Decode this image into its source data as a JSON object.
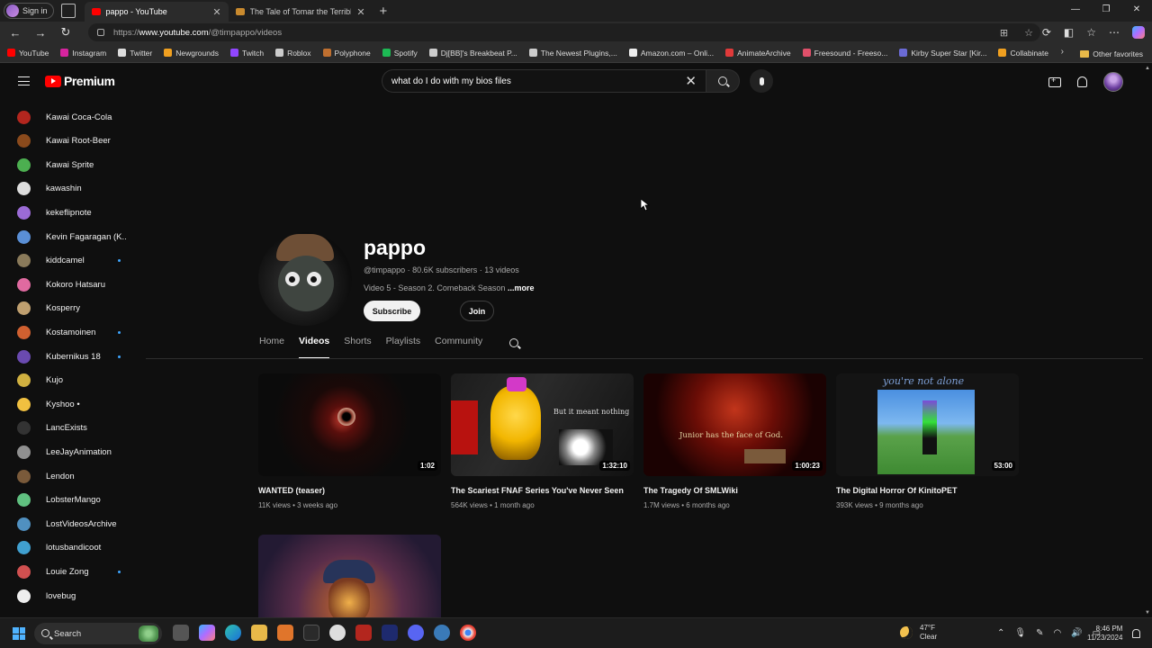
{
  "browser": {
    "signin_label": "Sign in",
    "tabs": [
      {
        "title": "pappo - YouTube",
        "favicon_color": "#ff0000",
        "active": true
      },
      {
        "title": "The Tale of Tomar the Terrible (Ar",
        "favicon_color": "#c98a2e",
        "active": false
      }
    ],
    "url_prefix": "https://",
    "url_host": "www.youtube.com",
    "url_path": "/@timpappo/videos",
    "bookmarks": [
      {
        "label": "YouTube",
        "color": "#ff0000"
      },
      {
        "label": "Instagram",
        "color": "#d6249f"
      },
      {
        "label": "Twitter",
        "color": "#dddddd"
      },
      {
        "label": "Newgrounds",
        "color": "#f0a020"
      },
      {
        "label": "Twitch",
        "color": "#9146ff"
      },
      {
        "label": "Roblox",
        "color": "#cccccc"
      },
      {
        "label": "Polyphone",
        "color": "#c07030"
      },
      {
        "label": "Spotify",
        "color": "#1db954"
      },
      {
        "label": "Dj[BB]'s Breakbeat P...",
        "color": "#cccccc"
      },
      {
        "label": "The Newest Plugins,...",
        "color": "#cccccc"
      },
      {
        "label": "Amazon.com – Onli...",
        "color": "#eeeeee"
      },
      {
        "label": "AnimateArchive",
        "color": "#e03a3a"
      },
      {
        "label": "Freesound - Freeso...",
        "color": "#e0506a"
      },
      {
        "label": "Kirby Super Star [Kir...",
        "color": "#6b6bd6"
      },
      {
        "label": "Collabinate",
        "color": "#f0a020"
      }
    ],
    "other_favorites": "Other favorites"
  },
  "youtube": {
    "logo_text": "Premium",
    "search_query": "what do I do with my bios files",
    "sidebar_subs": [
      {
        "name": "Kawai Coca-Cola",
        "color": "#b3261e",
        "live": false
      },
      {
        "name": "Kawai Root-Beer",
        "color": "#8a4a1c",
        "live": false
      },
      {
        "name": "Kawai Sprite",
        "color": "#4caf50",
        "live": false
      },
      {
        "name": "kawashin",
        "color": "#dddddd",
        "live": false
      },
      {
        "name": "kekeflipnote",
        "color": "#9b6bd6",
        "live": false
      },
      {
        "name": "Kevin Fagaragan (K...",
        "color": "#5a8fd6",
        "live": false
      },
      {
        "name": "kiddcamel",
        "color": "#8a7a5a",
        "live": true
      },
      {
        "name": "Kokoro Hatsaru",
        "color": "#e06aa0",
        "live": false
      },
      {
        "name": "Kosperry",
        "color": "#c0a070",
        "live": false
      },
      {
        "name": "Kostamoinen",
        "color": "#d06030",
        "live": true
      },
      {
        "name": "Kubernikus 18",
        "color": "#6a4ab0",
        "live": true
      },
      {
        "name": "Kujo",
        "color": "#d0b040",
        "live": false
      },
      {
        "name": "Kyshoo •",
        "color": "#f0c040",
        "live": false
      },
      {
        "name": "LancExists",
        "color": "#333333",
        "live": false
      },
      {
        "name": "LeeJayAnimation",
        "color": "#909090",
        "live": false
      },
      {
        "name": "Lendon",
        "color": "#7a5a3a",
        "live": false
      },
      {
        "name": "LobsterMango",
        "color": "#60c080",
        "live": false
      },
      {
        "name": "LostVideosArchive",
        "color": "#5090c0",
        "live": false
      },
      {
        "name": "lotusbandicoot",
        "color": "#40a0d0",
        "live": false
      },
      {
        "name": "Louie Zong",
        "color": "#d05050",
        "live": true
      },
      {
        "name": "lovebug",
        "color": "#eeeeee",
        "live": false
      }
    ],
    "channel": {
      "name": "pappo",
      "handle": "@timpappo",
      "subscribers": "80.6K subscribers",
      "videos_count": "13 videos",
      "description": "Video 5 - Season 2. Comeback Season",
      "more_label": "...more",
      "subscribe_label": "Subscribe",
      "join_label": "Join"
    },
    "tabs": [
      "Home",
      "Videos",
      "Shorts",
      "Playlists",
      "Community"
    ],
    "active_tab": "Videos",
    "videos": [
      {
        "title": "WANTED (teaser)",
        "duration": "1:02",
        "views": "11K views",
        "age": "3 weeks ago"
      },
      {
        "title": "The Scariest FNAF Series You've Never Seen",
        "duration": "1:32:10",
        "views": "564K views",
        "age": "1 month ago",
        "thumb_text": "But it meant nothing"
      },
      {
        "title": "The Tragedy Of SMLWiki",
        "duration": "1:00:23",
        "views": "1.7M views",
        "age": "6 months ago",
        "thumb_text": "Junior has the face of God."
      },
      {
        "title": "The Digital Horror Of KinitoPET",
        "duration": "53:00",
        "views": "393K views",
        "age": "9 months ago",
        "thumb_text": "you're not alone"
      }
    ]
  },
  "taskbar": {
    "search_label": "Search",
    "temperature": "47°F",
    "weather": "Clear",
    "time": "8:46 PM",
    "date": "11/23/2024"
  }
}
